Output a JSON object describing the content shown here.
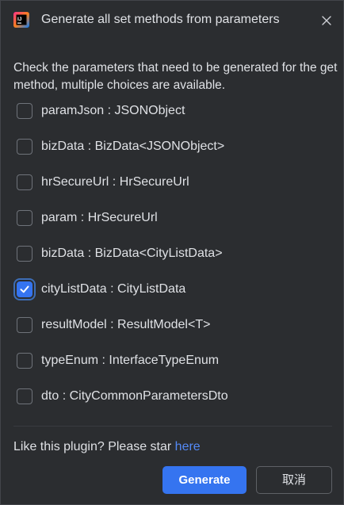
{
  "window": {
    "title": "Generate all set methods from parameters",
    "app_icon": "intellij-idea-icon",
    "close_icon": "close-icon"
  },
  "description": "Check the parameters that need to be generated for the get method, multiple choices are available.",
  "parameters": [
    {
      "label": "paramJson : JSONObject",
      "checked": false
    },
    {
      "label": "bizData : BizData<JSONObject>",
      "checked": false
    },
    {
      "label": "hrSecureUrl : HrSecureUrl",
      "checked": false
    },
    {
      "label": "param : HrSecureUrl",
      "checked": false
    },
    {
      "label": "bizData : BizData<CityListData>",
      "checked": false
    },
    {
      "label": "cityListData : CityListData",
      "checked": true
    },
    {
      "label": "resultModel : ResultModel<T>",
      "checked": false
    },
    {
      "label": "typeEnum : InterfaceTypeEnum",
      "checked": false
    },
    {
      "label": "dto : CityCommonParametersDto",
      "checked": false
    }
  ],
  "footer": {
    "text": "Like this plugin? Please star ",
    "link": "here"
  },
  "buttons": {
    "generate": "Generate",
    "cancel": "取消"
  },
  "colors": {
    "background": "#2b2d30",
    "accent": "#3574f0",
    "link": "#548af7",
    "text": "#dfe1e5"
  }
}
